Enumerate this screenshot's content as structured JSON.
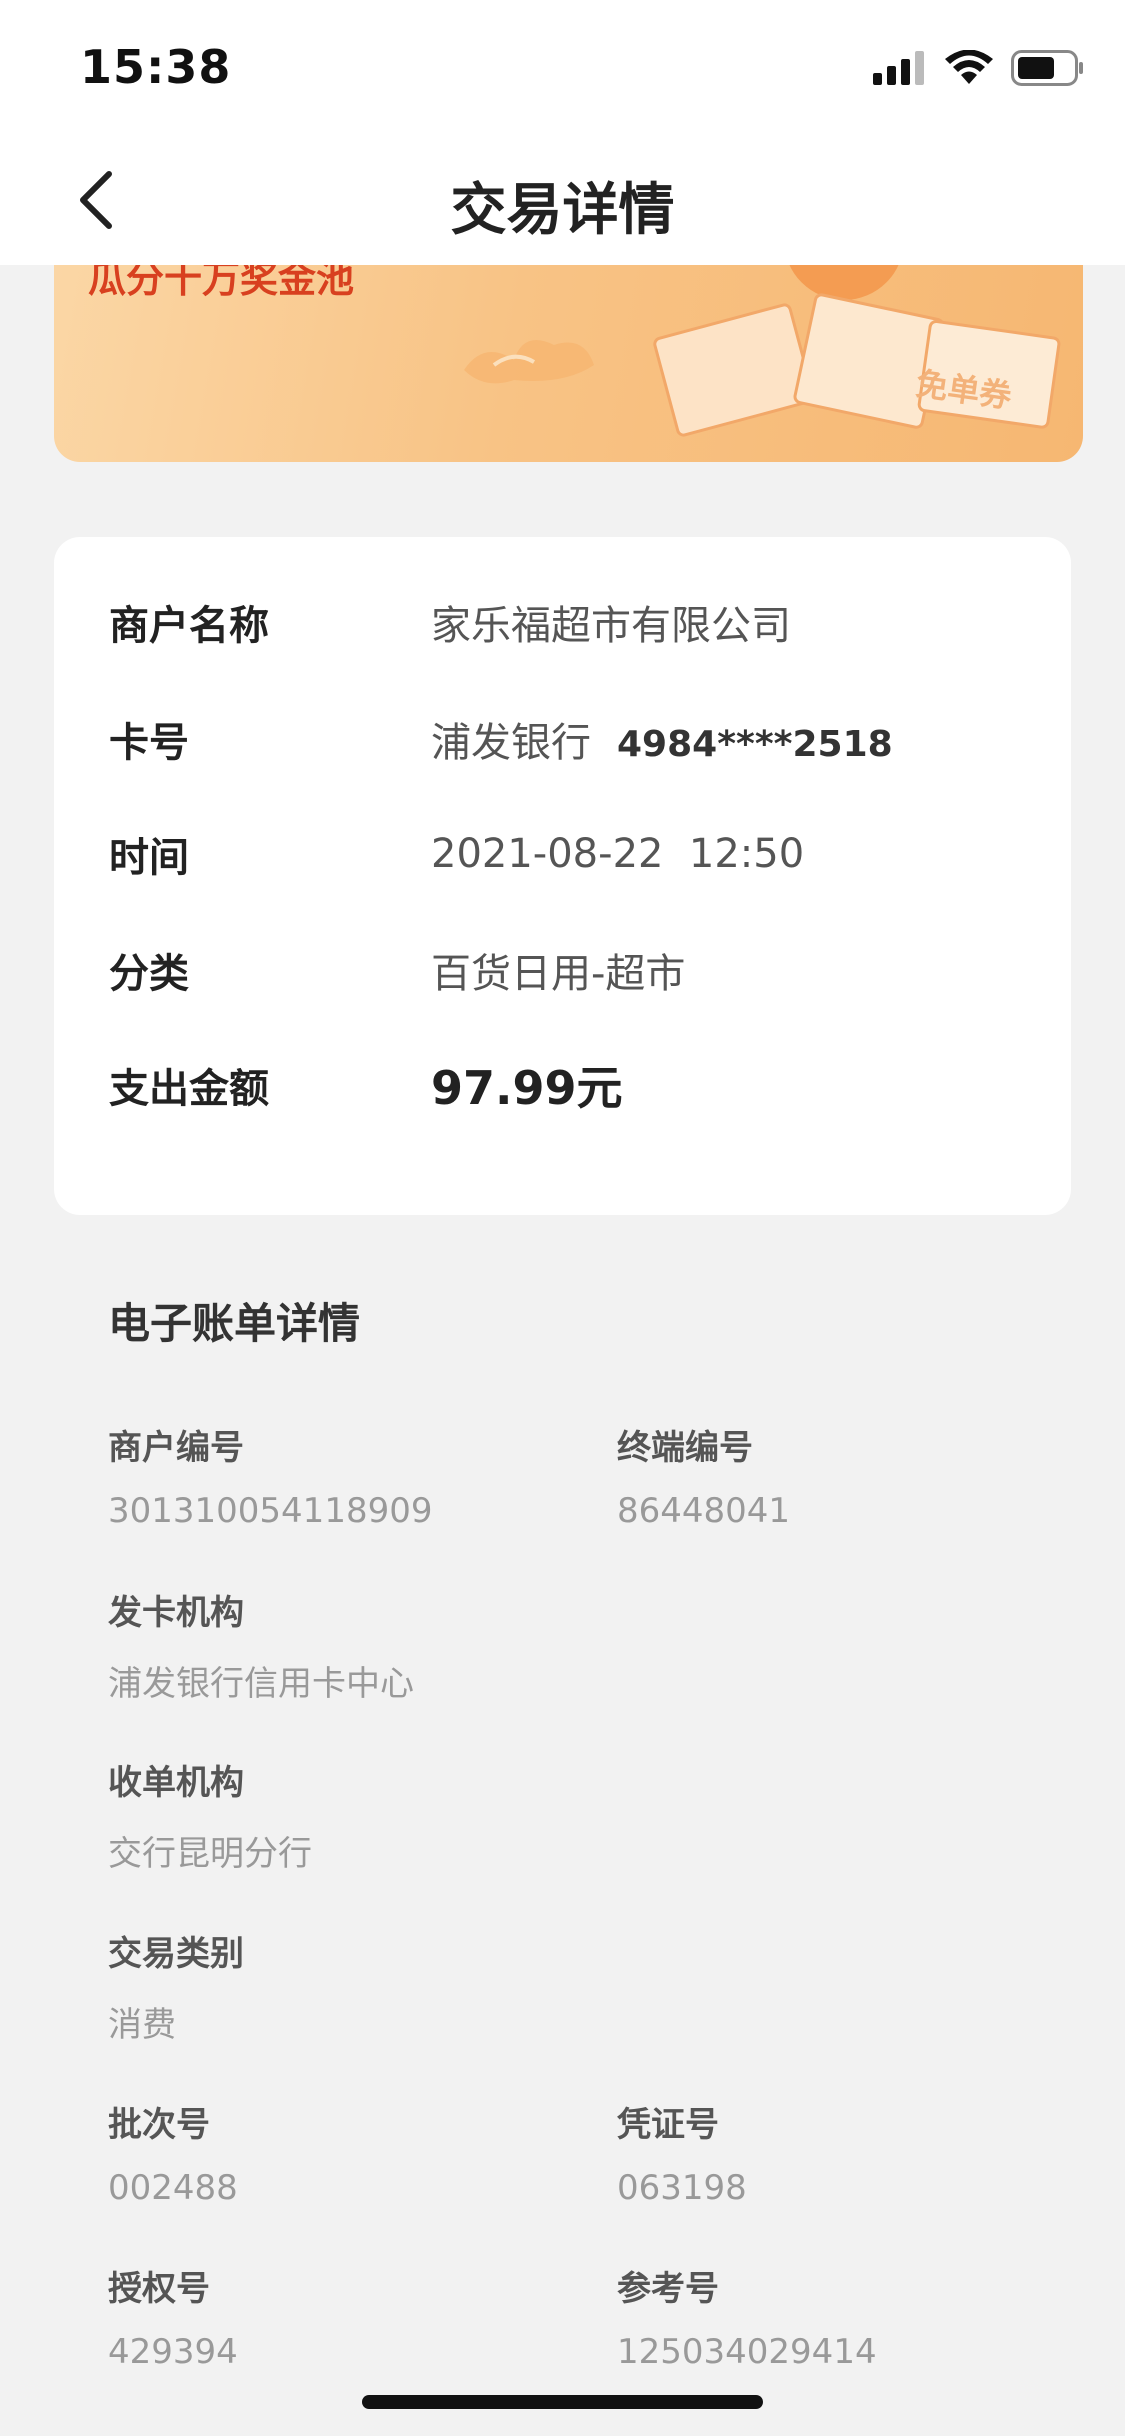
{
  "status_bar": {
    "time": "15:38"
  },
  "nav": {
    "title": "交易详情"
  },
  "banner": {
    "text": "瓜分十万奖金池",
    "coupon_text": "免单券"
  },
  "transaction": {
    "merchant_label": "商户名称",
    "merchant_value": "家乐福超市有限公司",
    "card_label": "卡号",
    "card_bank": "浦发银行",
    "card_number": "4984****2518",
    "time_label": "时间",
    "time_value": "2021-08-22  12:50",
    "category_label": "分类",
    "category_value": "百货日用-超市",
    "amount_label": "支出金额",
    "amount_value": "97.99元"
  },
  "ebill": {
    "title": "电子账单详情",
    "merchant_no_label": "商户编号",
    "merchant_no": "301310054118909",
    "terminal_no_label": "终端编号",
    "terminal_no": "86448041",
    "issuer_label": "发卡机构",
    "issuer": "浦发银行信用卡中心",
    "acquirer_label": "收单机构",
    "acquirer": "交行昆明分行",
    "type_label": "交易类别",
    "type": "消费",
    "batch_label": "批次号",
    "batch": "002488",
    "voucher_label": "凭证号",
    "voucher": "063198",
    "auth_label": "授权号",
    "auth": "429394",
    "ref_label": "参考号",
    "ref": "125034029414"
  }
}
